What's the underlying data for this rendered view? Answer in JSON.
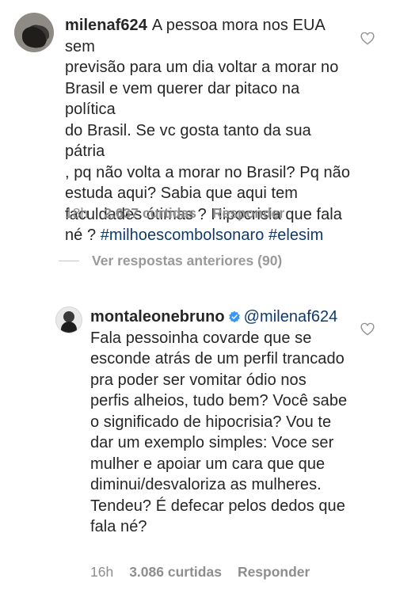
{
  "comment1": {
    "username": "milenaf624",
    "lines": [
      "A pessoa mora nos EUA sem",
      "previsão para um dia voltar a morar no",
      "Brasil e vem querer dar pitaco na política",
      "do Brasil. Se vc gosta tanto da sua pátria",
      ", pq não volta a morar no Brasil? Pq não",
      "estuda aqui? Sabia que aqui tem",
      "faculdades ótimas ? Hipocrisia que fala"
    ],
    "last_line_prefix": "né ?",
    "hashtags": [
      "#milhoescombolsonaro",
      "#elesim"
    ],
    "time": "18h",
    "likes": "2.637 curtidas",
    "reply": "Responder"
  },
  "view_replies": "Ver respostas anteriores (90)",
  "comment2": {
    "username": "montaleonebruno",
    "mention": "@milenaf624",
    "lines": [
      "Fala pessoinha covarde que se",
      "esconde atrás de um perfil trancado",
      "pra poder ser vomitar ódio nos",
      "perfis alheios, tudo bem? Você sabe",
      "o significado de hipocrisia? Vou te",
      "dar um exemplo simples: Voce ser",
      "mulher e apoiar um cara que que",
      "diminui/desvaloriza as mulheres.",
      "Tendeu? É defecar pelos dedos que",
      "fala né?"
    ],
    "time": "16h",
    "likes": "3.086 curtidas",
    "reply": "Responder"
  },
  "icons": {
    "heart": "heart-outline-icon",
    "verified": "verified-badge-icon",
    "verified_color": "#3897f0"
  }
}
